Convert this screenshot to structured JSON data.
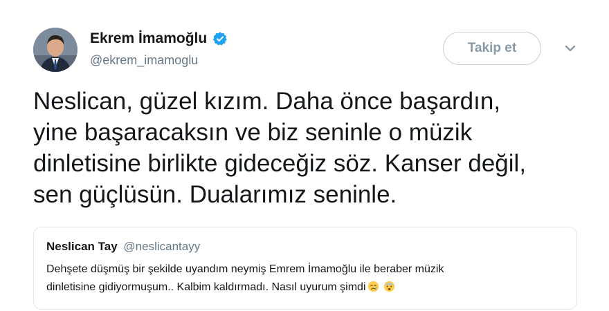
{
  "author": {
    "name": "Ekrem İmamoğlu",
    "handle": "@ekrem_imamoglu",
    "verified": true
  },
  "follow_button": {
    "label": "Takip et"
  },
  "tweet": {
    "lines": [
      "Neslican, güzel kızım. Daha önce başardın,",
      "yine başaracaksın ve biz seninle o müzik",
      "dinletisine birlikte gideceğiz söz. Kanser değil,",
      "sen güçlüsün. Dualarımız seninle."
    ]
  },
  "quoted_tweet": {
    "name": "Neslican Tay",
    "handle": "@neslicantayy",
    "lines": [
      "Dehşete düşmüş bir şekilde uyandım neymiş Emrem İmamoğlu ile beraber müzik",
      "dinletisine gidiyormuşum.. Kalbim kaldırmadı. Nasıl uyurum şimdi"
    ],
    "emojis": [
      "crying-face-emoji",
      "fearful-face-emoji"
    ]
  },
  "colors": {
    "verified_blue": "#1da1f2",
    "muted_gray": "#657786",
    "border": "#e1e8ed"
  }
}
